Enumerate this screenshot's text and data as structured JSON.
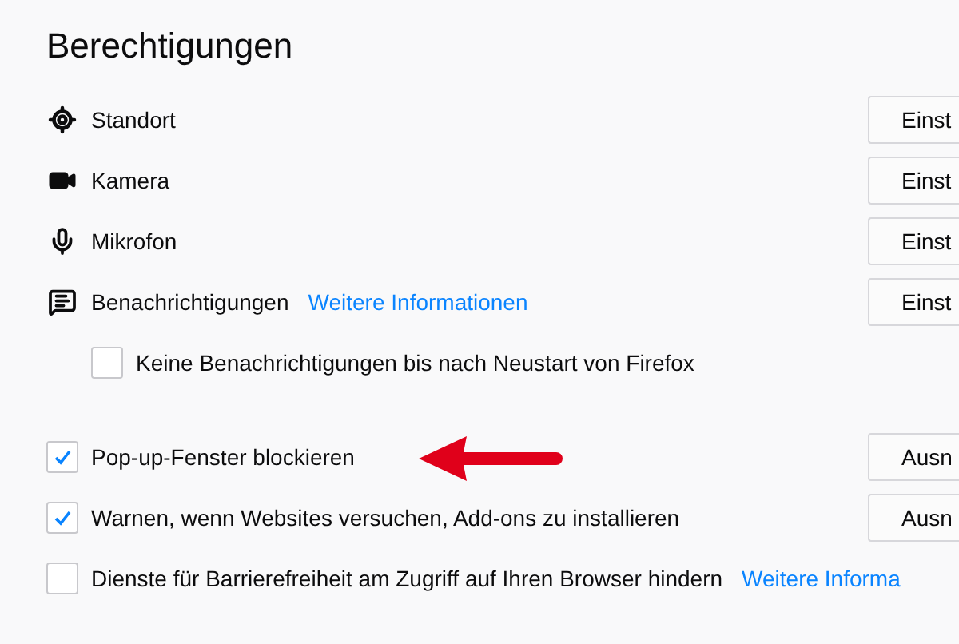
{
  "title": "Berechtigungen",
  "permissions": [
    {
      "kind": "location",
      "label": "Standort",
      "button": "Einst"
    },
    {
      "kind": "camera",
      "label": "Kamera",
      "button": "Einst"
    },
    {
      "kind": "microphone",
      "label": "Mikrofon",
      "button": "Einst"
    },
    {
      "kind": "notifications",
      "label": "Benachrichtigungen",
      "link": "Weitere Informationen",
      "button": "Einst"
    }
  ],
  "notifications_option": {
    "label": "Keine Benachrichtigungen bis nach Neustart von Firefox",
    "checked": false
  },
  "options": [
    {
      "label": "Pop-up-Fenster blockieren",
      "checked": true,
      "button": "Ausn",
      "annotated": true
    },
    {
      "label": "Warnen, wenn Websites versuchen, Add-ons zu installieren",
      "checked": true,
      "button": "Ausn",
      "annotated": false
    },
    {
      "label": "Dienste für Barrierefreiheit am Zugriff auf Ihren Browser hindern",
      "checked": false,
      "link": "Weitere Informa",
      "annotated": false
    }
  ]
}
